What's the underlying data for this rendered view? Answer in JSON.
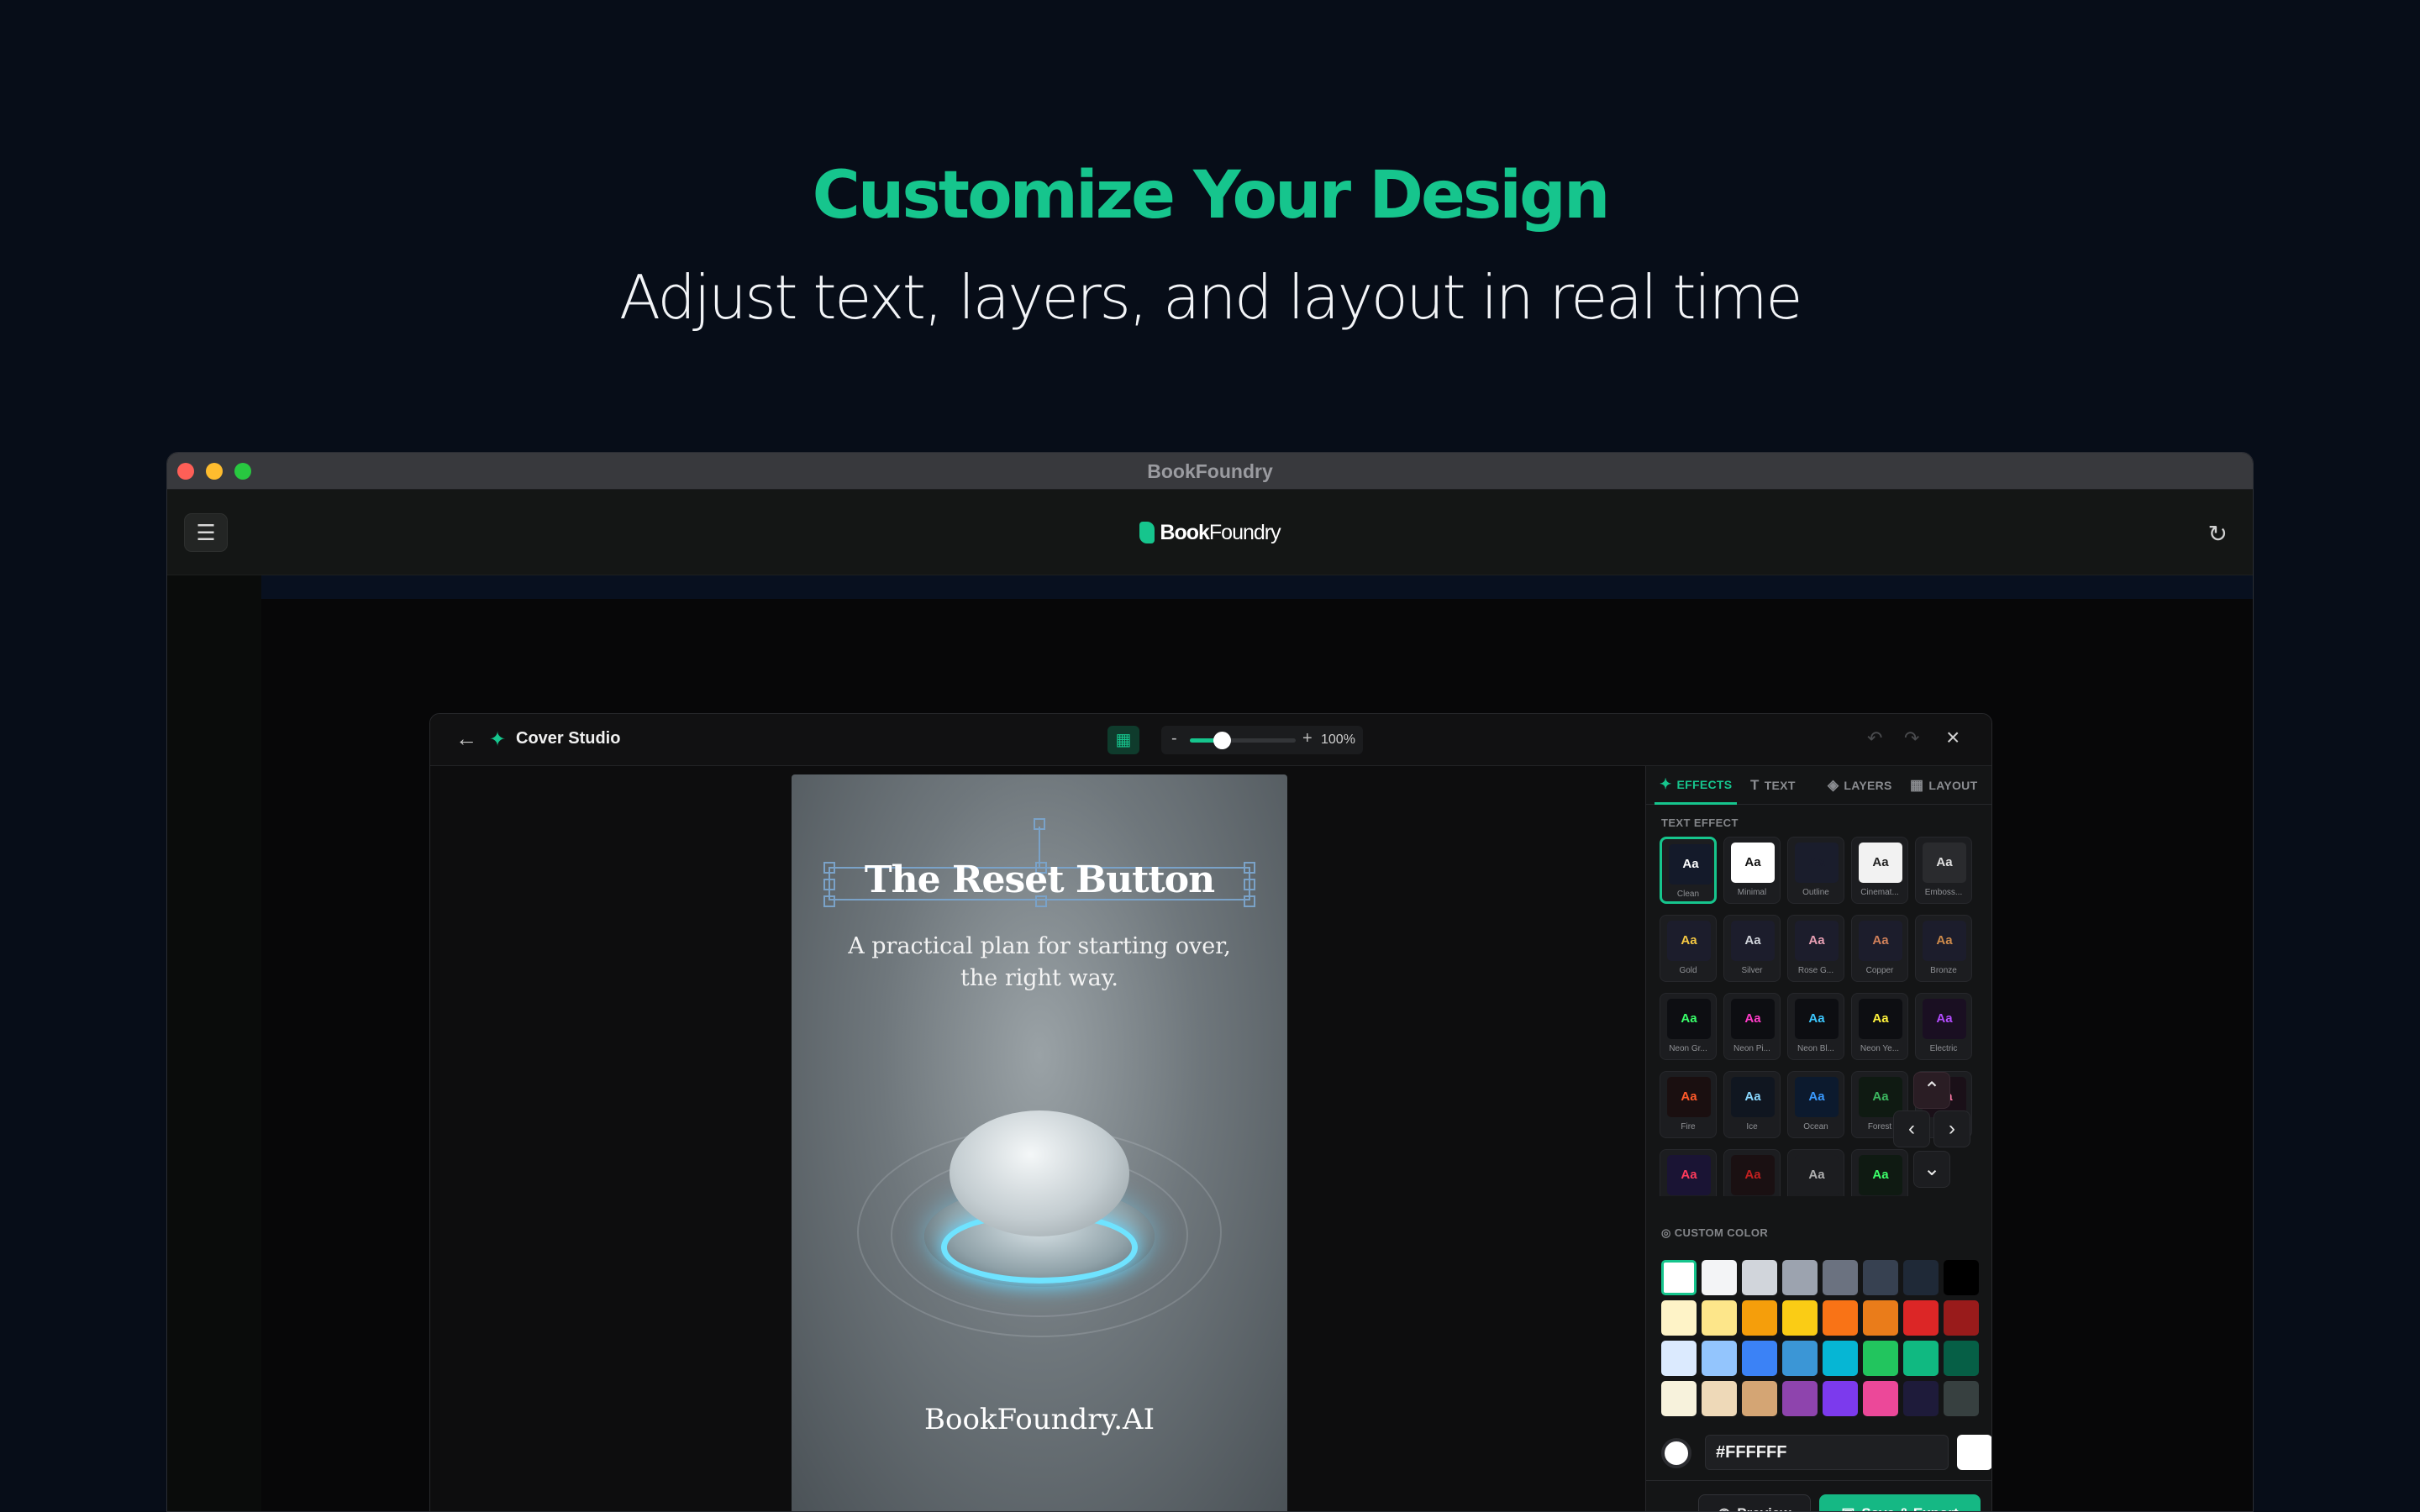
{
  "hero": {
    "title": "Customize Your Design",
    "subtitle": "Adjust text, layers, and layout in real time"
  },
  "window": {
    "title": "BookFoundry"
  },
  "appbar": {
    "menu_icon": "hamburger-icon",
    "brand_bold": "Book",
    "brand_light": "Foundry",
    "refresh_icon": "refresh-icon"
  },
  "studio": {
    "title": "Cover Studio",
    "zoom_minus": "-",
    "zoom_plus": "+",
    "zoom_value": "100%",
    "zoom_fraction": 0.3
  },
  "cover": {
    "title": "The Reset Button",
    "subtitle": "A practical plan for starting over, the right way.",
    "footer": "BookFoundry.AI"
  },
  "tabs": [
    {
      "label": "EFFECTS",
      "icon": "sparkle-icon",
      "active": true
    },
    {
      "label": "TEXT",
      "icon": "text-icon",
      "active": false
    },
    {
      "label": "LAYERS",
      "icon": "layers-icon",
      "active": false
    },
    {
      "label": "LAYOUT",
      "icon": "layout-icon",
      "active": false
    }
  ],
  "text_effect_label": "TEXT EFFECT",
  "effects": [
    {
      "name": "Clean",
      "bg": "#141a2a",
      "fg": "#ffffff",
      "selected": true
    },
    {
      "name": "Minimal",
      "bg": "#ffffff",
      "fg": "#111111"
    },
    {
      "name": "Outline",
      "bg": "#1a1d2c",
      "fg": "#1a1d2c"
    },
    {
      "name": "Cinemat...",
      "bg": "#f2f2f2",
      "fg": "#222222"
    },
    {
      "name": "Emboss...",
      "bg": "#2a2b2e",
      "fg": "#e0e0e0"
    },
    {
      "name": "Gold",
      "bg": "#1c1d2c",
      "fg": "#f5c842"
    },
    {
      "name": "Silver",
      "bg": "#1c1d2c",
      "fg": "#d0d4da"
    },
    {
      "name": "Rose G...",
      "bg": "#1c1d2c",
      "fg": "#e8a0b4"
    },
    {
      "name": "Copper",
      "bg": "#1c1d2c",
      "fg": "#d0805a"
    },
    {
      "name": "Bronze",
      "bg": "#1c1d2c",
      "fg": "#cd8a4a"
    },
    {
      "name": "Neon Gr...",
      "bg": "#0d0e12",
      "fg": "#39ff6a"
    },
    {
      "name": "Neon Pi...",
      "bg": "#0d0e12",
      "fg": "#ff3cc8"
    },
    {
      "name": "Neon Bl...",
      "bg": "#0d0e12",
      "fg": "#3cc8ff"
    },
    {
      "name": "Neon Ye...",
      "bg": "#0d0e12",
      "fg": "#fff23c"
    },
    {
      "name": "Electric",
      "bg": "#1a0f22",
      "fg": "#b44cff"
    },
    {
      "name": "Fire",
      "bg": "#1a0f10",
      "fg": "#ff5a2a"
    },
    {
      "name": "Ice",
      "bg": "#101620",
      "fg": "#8ad8ff"
    },
    {
      "name": "Ocean",
      "bg": "#0c1a2e",
      "fg": "#3a9aff"
    },
    {
      "name": "Forest",
      "bg": "#0f1a12",
      "fg": "#3cb860"
    },
    {
      "name": "",
      "bg": "#1a1018",
      "fg": "#ff7aa8"
    },
    {
      "name": "",
      "bg": "#1a1434",
      "fg": "#ff3b5c"
    },
    {
      "name": "",
      "bg": "#1a1012",
      "fg": "#c42020"
    },
    {
      "name": "",
      "bg": "#1c1d20",
      "fg": "#b0b0b0"
    },
    {
      "name": "",
      "bg": "#0f1a12",
      "fg": "#3cff6a"
    }
  ],
  "nav": {
    "up_icon": "chevron-up-icon",
    "left_icon": "chevron-left-icon",
    "right_icon": "chevron-right-icon",
    "down_icon": "chevron-down-icon"
  },
  "custom_color_label": "CUSTOM COLOR",
  "colors": [
    "#ffffff",
    "#f3f4f6",
    "#d1d5db",
    "#9ca3af",
    "#6b7280",
    "#374151",
    "#1f2937",
    "#000000",
    "#fef3c7",
    "#fde68a",
    "#f59e0b",
    "#facc15",
    "#f97316",
    "#ea7c1a",
    "#dc2626",
    "#991b1b",
    "#dbeafe",
    "#93c5fd",
    "#3b82f6",
    "#3b96d6",
    "#06b6d4",
    "#22c55e",
    "#10b981",
    "#065f46",
    "#f7f2dc",
    "#eed9b8",
    "#d4a574",
    "#8e44ad",
    "#7c3aed",
    "#ec4899",
    "#1e1b3a",
    "#374040"
  ],
  "hex": {
    "value": "#FFFFFF"
  },
  "actions": {
    "preview": "Preview",
    "save": "Save & Export"
  }
}
